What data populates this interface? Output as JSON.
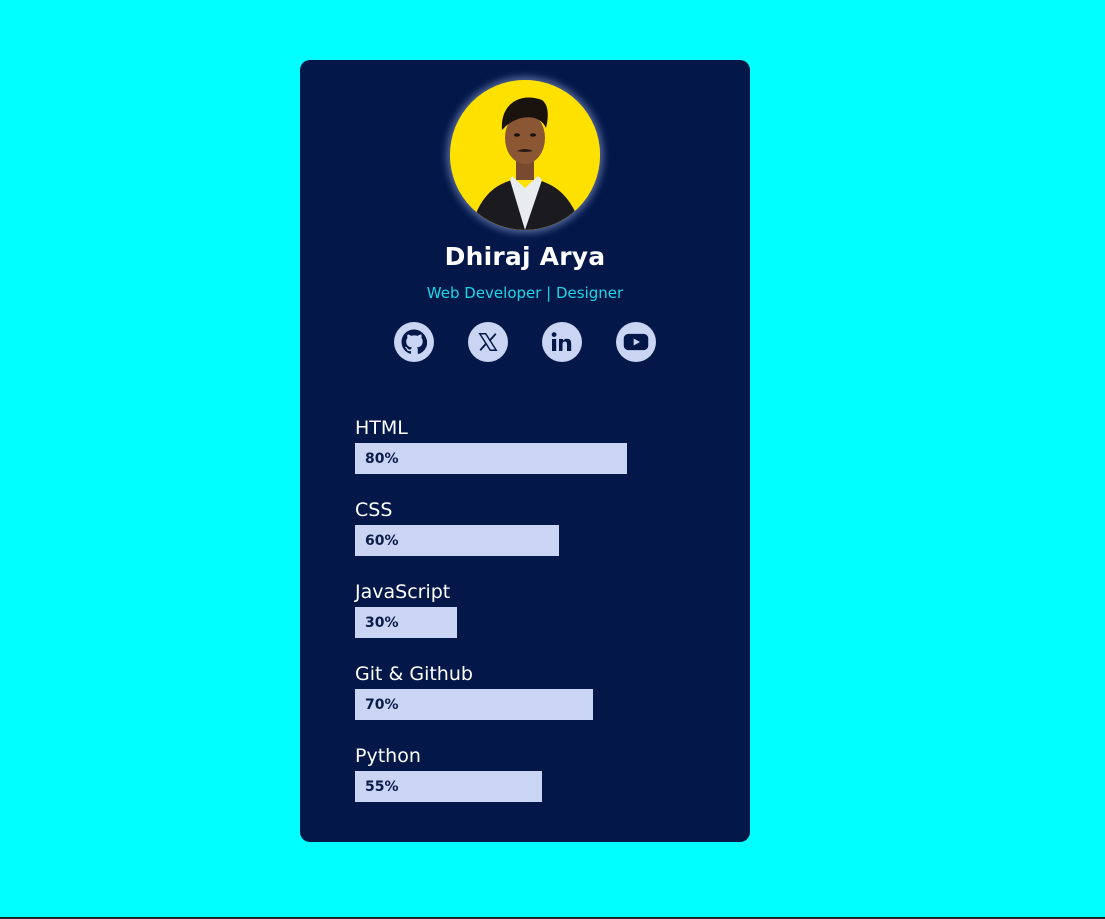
{
  "profile": {
    "name": "Dhiraj Arya",
    "role": "Web Developer | Designer"
  },
  "socials": [
    {
      "name": "github",
      "icon": "github-icon"
    },
    {
      "name": "x",
      "icon": "x-icon"
    },
    {
      "name": "linkedin",
      "icon": "linkedin-icon"
    },
    {
      "name": "youtube",
      "icon": "youtube-icon"
    }
  ],
  "skills": [
    {
      "name": "HTML",
      "label": "80%",
      "value": 80
    },
    {
      "name": "CSS",
      "label": "60%",
      "value": 60
    },
    {
      "name": "JavaScript",
      "label": "30%",
      "value": 30
    },
    {
      "name": "Git & Github",
      "label": "70%",
      "value": 70
    },
    {
      "name": "Python",
      "label": "55%",
      "value": 55
    }
  ],
  "colors": {
    "background": "#00ffff",
    "card": "#031849",
    "accent": "#19d6e8",
    "bar": "#c9d5f2",
    "avatar_bg": "#ffe100"
  }
}
